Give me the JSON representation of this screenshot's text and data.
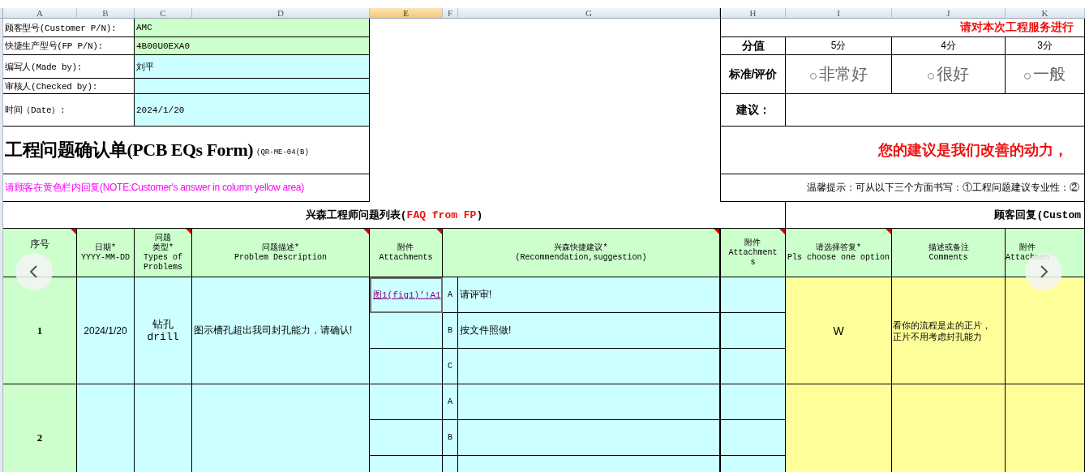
{
  "column_headers": [
    {
      "label": "A",
      "selected": false
    },
    {
      "label": "B",
      "selected": false
    },
    {
      "label": "C",
      "selected": false
    },
    {
      "label": "D",
      "selected": false
    },
    {
      "label": "E",
      "selected": true
    },
    {
      "label": "F",
      "selected": false
    },
    {
      "label": "G",
      "selected": false
    },
    {
      "label": "H",
      "selected": false
    },
    {
      "label": "I",
      "selected": false
    },
    {
      "label": "J",
      "selected": false
    },
    {
      "label": "K",
      "selected": false
    }
  ],
  "info_rows": [
    {
      "label": "顾客型号(Customer P/N):",
      "value": "AMC",
      "color": "#ccffcc"
    },
    {
      "label": "快捷生产型号(FP P/N):",
      "value": "4B00U0EXA0",
      "color": "#ccffcc"
    },
    {
      "label": "编写人(Made by):",
      "value": "刘平",
      "color": "#ccffff"
    },
    {
      "label": "审核人(Checked by):",
      "color": "#ccffff"
    },
    {
      "label": "时间（Date）:",
      "value": "2024/1/20",
      "color": "#ccffff"
    }
  ],
  "form_title": {
    "main": "工程问题确认单(PCB EQs Form)",
    "code": "(QR-ME-04(B)"
  },
  "note": "请顾客在黄色栏内回复(NOTE:Customer's answer in column yellow area)",
  "rating": {
    "title": "请对本次工程服务进行",
    "score_label": "分值",
    "scores": [
      "5分",
      "4分",
      "3分"
    ],
    "criteria_label": "标准/评价",
    "options": [
      {
        "label": "非常好",
        "selected": false
      },
      {
        "label": "很好",
        "selected": false
      },
      {
        "label": "一般",
        "selected": false
      }
    ],
    "suggestion_label": "建议：",
    "slogan": "您的建议是我们改善的动力，",
    "tip": "温馨提示：可从以下三个方面书写：①工程问题建议专业性：②"
  },
  "sections": {
    "engineer": {
      "text": "兴森工程师问题列表(",
      "highlight": "FAQ from FP",
      "end": ")"
    },
    "customer": "顾客回复(Custom"
  },
  "columns": [
    {
      "lines": [
        "序号"
      ],
      "comment": true
    },
    {
      "lines": [
        "日期*",
        "YYYY-MM-DD"
      ],
      "comment": false
    },
    {
      "lines": [
        "问题",
        "类型*",
        "Types of",
        "Problems"
      ],
      "comment": true
    },
    {
      "lines": [
        "问题描述*",
        "Problem Description"
      ],
      "comment": true
    },
    {
      "lines": [
        "附件",
        "Attachments"
      ],
      "comment": true
    },
    {
      "lines": [
        "兴森快捷建议*",
        "(Recommendation,suggestion)"
      ],
      "comment": true
    },
    {
      "lines": [
        "附件",
        "Attachment",
        "s"
      ],
      "comment": true
    },
    {
      "lines": [
        "请选择答复*",
        "Pls choose one option"
      ],
      "comment": true
    },
    {
      "lines": [
        "描述或备注",
        "Comments"
      ],
      "comment": false
    },
    {
      "lines": [
        "附件",
        "Attachmen"
      ],
      "comment": false
    }
  ],
  "issues": [
    {
      "no": "1",
      "date": "2024/1/20",
      "type": "钻孔\ndrill",
      "description": "图示槽孔超出我司封孔能力，请确认!",
      "answer": "W",
      "comments": [
        "看你的流程是走的正片，",
        "正片不用考虑封孔能力"
      ],
      "subrows": [
        {
          "letter": "A",
          "text": "请评审!",
          "attachment": {
            "text": "图1(fig1)’!A1",
            "selected": true
          }
        },
        {
          "letter": "B",
          "text": "按文件照做!"
        },
        {
          "letter": "C"
        }
      ]
    },
    {
      "no": "2",
      "subrows": [
        {
          "letter": "A"
        },
        {
          "letter": "B"
        }
      ]
    }
  ]
}
